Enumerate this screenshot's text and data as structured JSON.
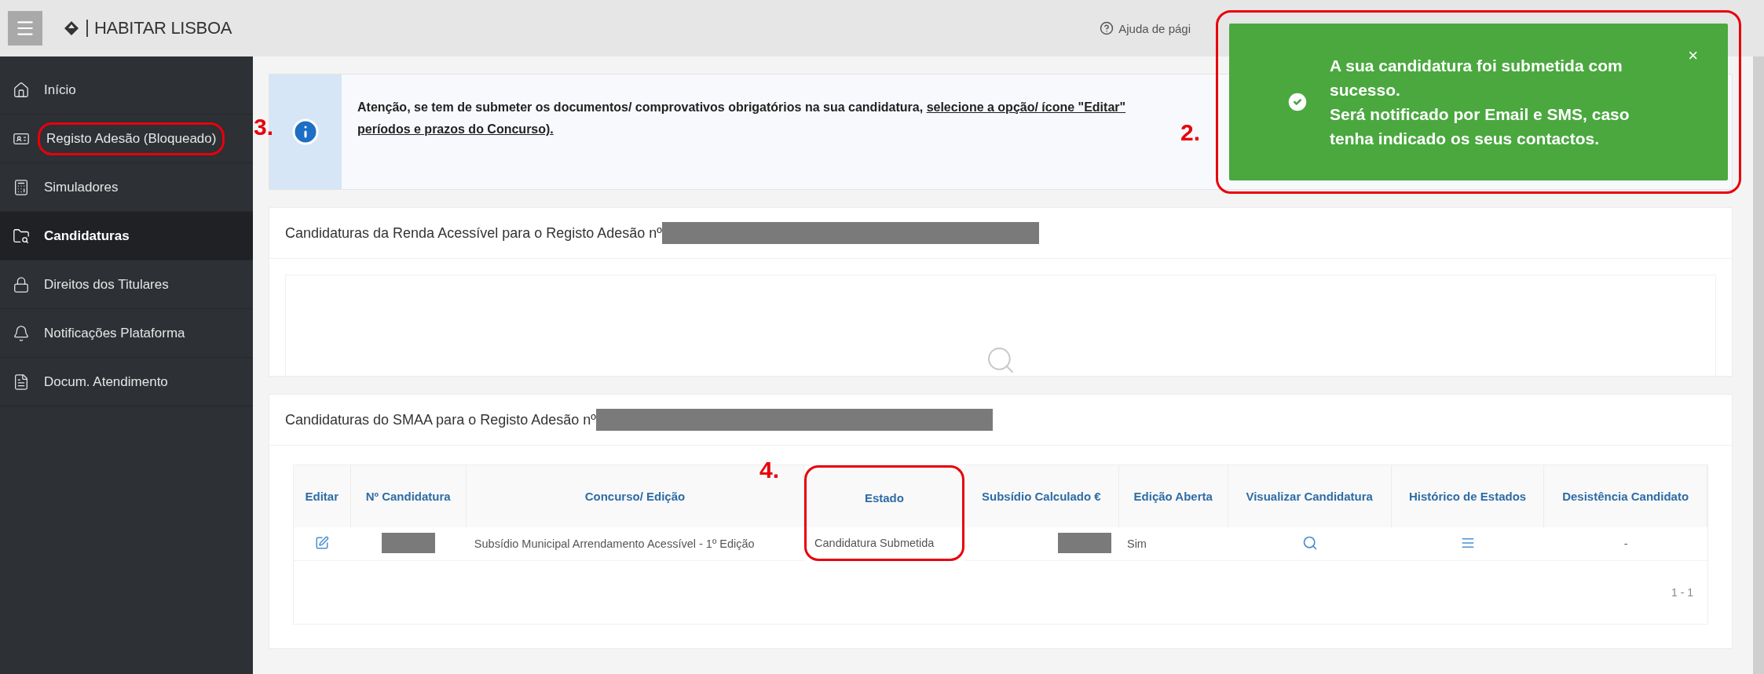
{
  "topbar": {
    "brand": "HABITAR LISBOA",
    "help": "Ajuda de pági"
  },
  "sidebar": {
    "items": [
      {
        "label": "Início",
        "selected": false,
        "highlighted": false
      },
      {
        "label": "Registo Adesão (Bloqueado)",
        "selected": false,
        "highlighted": true
      },
      {
        "label": "Simuladores",
        "selected": false,
        "highlighted": false
      },
      {
        "label": "Candidaturas",
        "selected": true,
        "highlighted": false
      },
      {
        "label": "Direitos dos Titulares",
        "selected": false,
        "highlighted": false
      },
      {
        "label": "Notificações Plataforma",
        "selected": false,
        "highlighted": false
      },
      {
        "label": "Docum. Atendimento",
        "selected": false,
        "highlighted": false
      }
    ]
  },
  "banner": {
    "callout": "3.",
    "text": "Atenção, se tem de submeter os documentos/ comprovativos obrigatórios na sua candidatura, ",
    "link": "selecione a opção/ ícone \"Editar\"",
    "link_continued": "períodos e prazos do Concurso)."
  },
  "toast": {
    "callout": "2.",
    "highlighted": true,
    "messages": [
      "A sua candidatura foi submetida com sucesso.",
      "Será notificado por Email e SMS, caso tenha indicado os seus contactos."
    ],
    "close": "×"
  },
  "renda_card": {
    "title": "Candidaturas da Renda Acessível para o Registo Adesão nº"
  },
  "smaa_card": {
    "title": "Candidaturas do SMAA para o Registo Adesão nº",
    "columns": [
      {
        "label": "Editar",
        "highlighted": false
      },
      {
        "label": "Nº Candidatura",
        "highlighted": false
      },
      {
        "label": "Concurso/ Edição",
        "highlighted": false
      },
      {
        "label": "Estado",
        "highlighted": true,
        "callout": "4."
      },
      {
        "label": "Subsídio Calculado €",
        "highlighted": false
      },
      {
        "label": "Edição Aberta",
        "highlighted": false
      },
      {
        "label": "Visualizar Candidatura",
        "highlighted": false
      },
      {
        "label": "Histórico de Estados",
        "highlighted": false
      },
      {
        "label": "Desistência Candidato",
        "highlighted": false
      }
    ],
    "rows": [
      {
        "cells": [
          {
            "kind": "edit"
          },
          {
            "kind": "redacted"
          },
          {
            "kind": "text",
            "text": "Subsídio Municipal Arrendamento Acessível - 1º Edição"
          },
          {
            "kind": "text",
            "text": "Candidatura Submetida"
          },
          {
            "kind": "redacted"
          },
          {
            "kind": "text",
            "text": "Sim"
          },
          {
            "kind": "view"
          },
          {
            "kind": "history"
          },
          {
            "kind": "text",
            "text": "-"
          }
        ]
      }
    ],
    "pagination": "1 - 1"
  }
}
